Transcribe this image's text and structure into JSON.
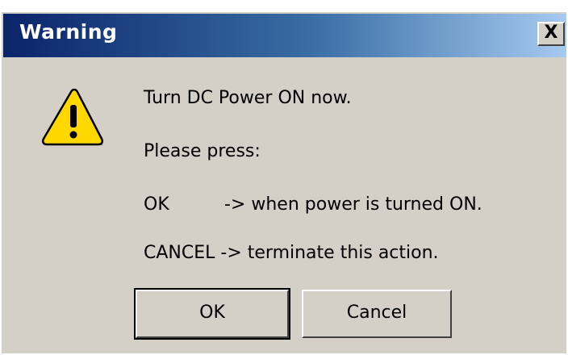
{
  "window": {
    "title": "Warning",
    "close_label": "X"
  },
  "icon": {
    "name": "warning-icon",
    "color": "#ffd800"
  },
  "message": {
    "line1": "Turn DC Power ON now.",
    "line2": "Please press:",
    "line3_key": "OK",
    "line3_text": "-> when power is turned ON.",
    "line4": "CANCEL -> terminate this action."
  },
  "buttons": {
    "ok_label": "OK",
    "cancel_label": "Cancel"
  },
  "colors": {
    "titlebar_start": "#0a246a",
    "titlebar_end": "#a6caf0",
    "face": "#d4d0c8"
  }
}
